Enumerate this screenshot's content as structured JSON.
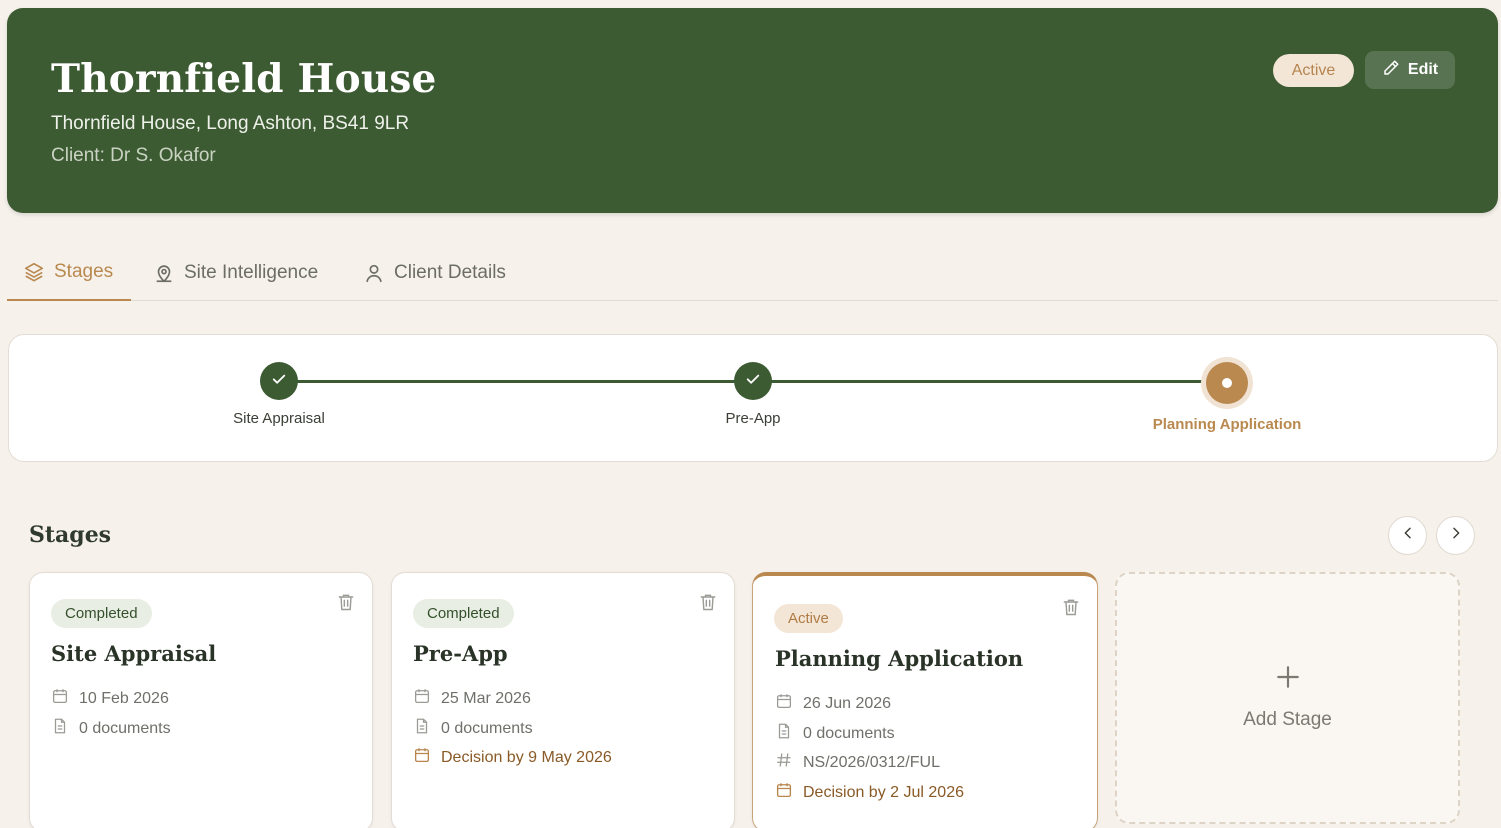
{
  "project": {
    "name": "Thornfield House",
    "address": "Thornfield House, Long Ashton, BS41 9LR",
    "client": "Client: Dr S. Okafor",
    "status": "Active",
    "edit_label": "Edit"
  },
  "tabs": [
    {
      "label": "Stages",
      "icon": "layers-icon",
      "active": true
    },
    {
      "label": "Site Intelligence",
      "icon": "map-pin-icon",
      "active": false
    },
    {
      "label": "Client Details",
      "icon": "user-icon",
      "active": false
    }
  ],
  "progress": {
    "steps": [
      {
        "label": "Site Appraisal",
        "state": "completed"
      },
      {
        "label": "Pre-App",
        "state": "completed"
      },
      {
        "label": "Planning Application",
        "state": "current"
      }
    ]
  },
  "stages_section": {
    "heading": "Stages",
    "add_label": "Add Stage"
  },
  "stage_cards": [
    {
      "status": "Completed",
      "title": "Site Appraisal",
      "date": "10 Feb 2026",
      "documents": "0 documents"
    },
    {
      "status": "Completed",
      "title": "Pre-App",
      "date": "25 Mar 2026",
      "documents": "0 documents",
      "decision": "Decision by 9 May 2026"
    },
    {
      "status": "Active",
      "title": "Planning Application",
      "date": "26 Jun 2026",
      "documents": "0 documents",
      "reference": "NS/2026/0312/FUL",
      "decision": "Decision by 2 Jul 2026"
    }
  ],
  "colors": {
    "brand_green": "#3d5b33",
    "accent_tan": "#b98950",
    "background": "#f6f1eb"
  }
}
